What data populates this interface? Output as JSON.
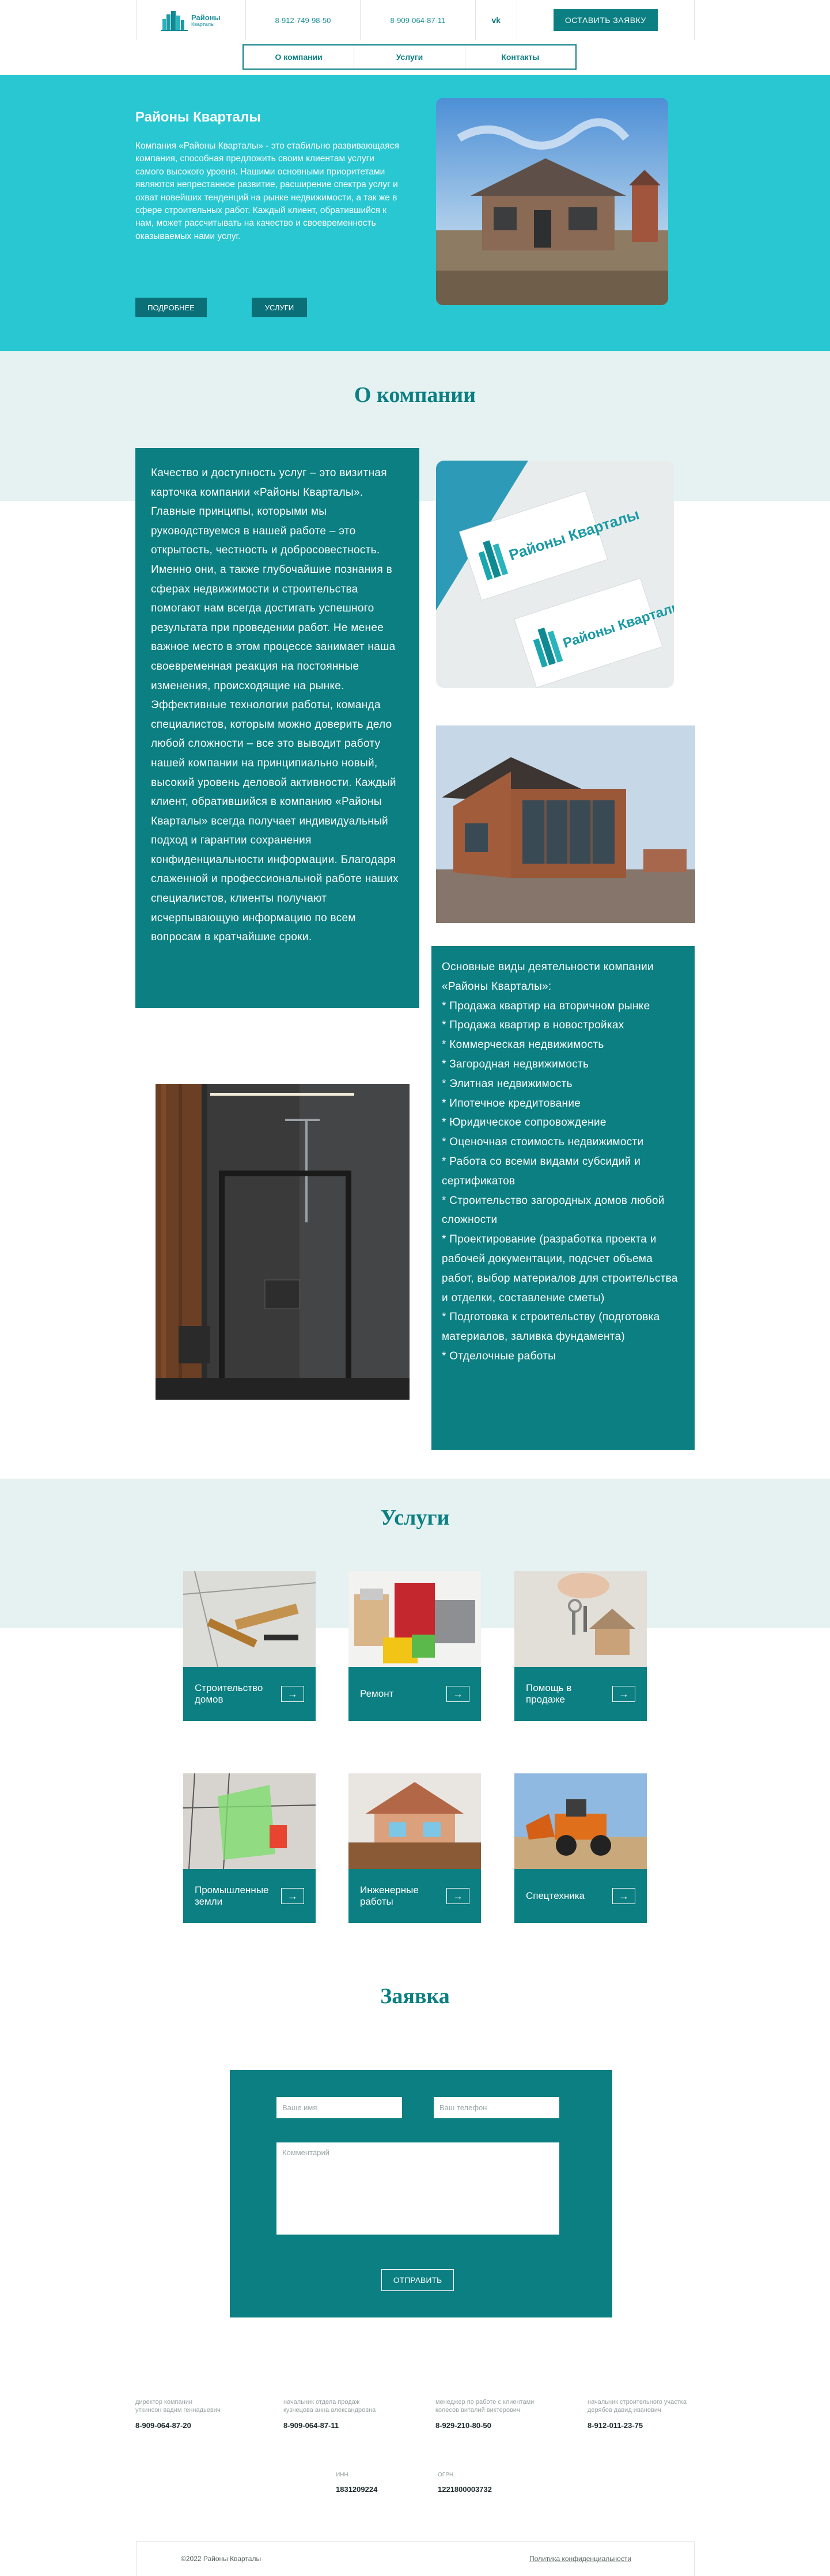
{
  "header": {
    "logo_name": "Районы",
    "logo_sub": "Кварталы",
    "phone_1": "8-912-749-98-50",
    "phone_2": "8-909-064-87-11",
    "vk_label": "vk",
    "cta_label": "ОСТАВИТЬ ЗАЯВКУ",
    "nav": [
      "О компании",
      "Услуги",
      "Контакты"
    ]
  },
  "hero": {
    "title": "Районы Кварталы",
    "text": "Компания «Районы Кварталы» - это стабильно развивающаяся компания, способная предложить своим клиентам услуги самого высокого уровня. Нашими основными приоритетами являются непрестанное развитие, расширение спектра услуг и охват новейших тенденций на рынке недвижимости, а так же в сфере строительных работ. Каждый клиент, обратившийся к нам, может рассчитывать на качество и своевременность оказываемых нами услуг.",
    "btn_more": "ПОДРОБНЕЕ",
    "btn_services": "УСЛУГИ"
  },
  "about": {
    "title": "О компании",
    "text": "Качество и доступность услуг – это визитная карточка компании «Районы Кварталы». Главные принципы, которыми мы руководствуемся в нашей работе – это открытость, честность и добросовестность. Именно они, а также глубочайшие познания в сферах недвижимости и строительства помогают нам всегда достигать успешного результата при проведении работ. Не менее важное место в этом процессе занимает наша своевременная реакция на постоянные изменения, происходящие на рынке. Эффективные технологии работы, команда специалистов, которым можно доверить дело любой сложности – все это выводит работу нашей компании на принципиально новый, высокий уровень деловой активности. Каждый клиент, обратившийся в компанию «Районы Кварталы» всегда получает индивидуальный подход и гарантии сохранения конфиденциальности информации. Благодаря слаженной и профессиональной работе наших специалистов, клиенты получают исчерпывающую информацию по всем вопросам в кратчайшие сроки.",
    "card_logo_text": "Районы Кварталы",
    "activities": [
      "Основные виды деятельности компании  «Районы Кварталы»:",
      "    * Продажа квартир на вторичном рынке",
      "    * Продажа квартир в новостройках",
      "    * Коммерческая недвижимость",
      "    * Загородная недвижимость",
      "    * Элитная недвижимость",
      "    * Ипотечное кредитование",
      "    * Юридическое сопровождение",
      "    * Оценочная стоимость недвижимости",
      "    * Работа со всеми видами субсидий и сертификатов",
      "    * Строительство загородных домов любой сложности",
      "    * Проектирование (разработка проекта и рабочей документации, подсчет объема работ, выбор материалов для строительства и отделки, составление сметы)",
      "    * Подготовка к строительству (подготовка материалов, заливка фундамента)",
      "    * Отделочные работы"
    ]
  },
  "services": {
    "title": "Услуги",
    "items": [
      {
        "label": "Строительство домов",
        "arrow": "→"
      },
      {
        "label": "Ремонт",
        "arrow": "→"
      },
      {
        "label": "Помощь в продаже",
        "arrow": "→"
      },
      {
        "label": "Промышленные земли",
        "arrow": "→"
      },
      {
        "label": "Инженерные работы",
        "arrow": "→"
      },
      {
        "label": "Спецтехника",
        "arrow": "→"
      }
    ]
  },
  "form": {
    "title": "Заявка",
    "name_placeholder": "Ваше имя",
    "phone_placeholder": "Ваш телефон",
    "comment_placeholder": "Комментарий",
    "submit_label": "ОТПРАВИТЬ"
  },
  "contacts": [
    {
      "role": "директор компании\nуткинсон вадим геннадьевич",
      "phone": "8-909-064-87-20"
    },
    {
      "role": "начальник отдела продаж\nкузнецова анна александровна",
      "phone": "8-909-064-87-11"
    },
    {
      "role": "менеджер по работе с клиентами\nколесов виталий виктерович",
      "phone": "8-929-210-80-50"
    },
    {
      "role": "начальник строительного участка\nдерябов давид иванович",
      "phone": "8-912-011-23-75"
    }
  ],
  "requisites": [
    {
      "label": "ИНН",
      "value": "1831209224"
    },
    {
      "label": "ОГРН",
      "value": "1221800003732"
    }
  ],
  "footer": {
    "copyright": "©2022 Районы Кварталы",
    "privacy": "Политика конфиденциальности"
  },
  "colors": {
    "teal_dark": "#0b7f82",
    "teal_light": "#28c7d2",
    "band_light": "#e5f2f1"
  }
}
